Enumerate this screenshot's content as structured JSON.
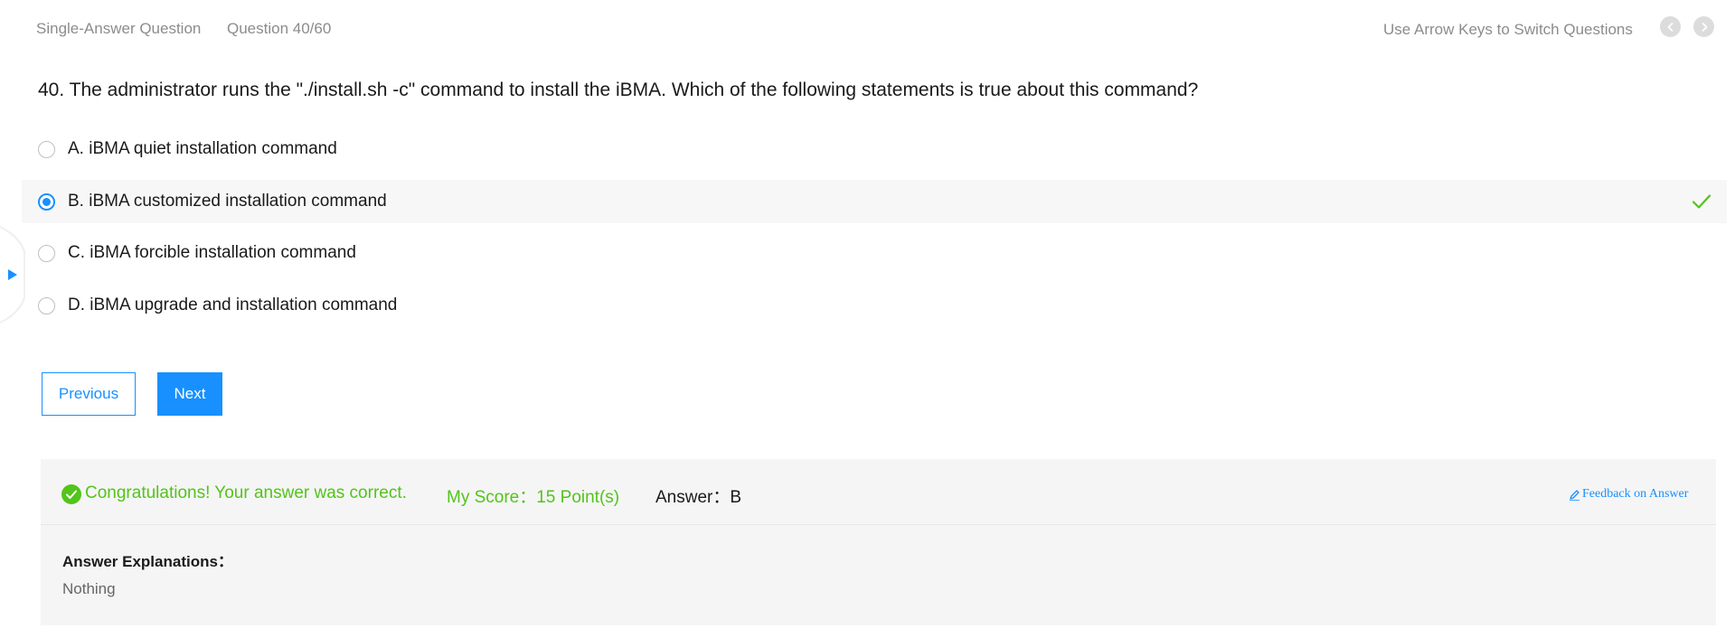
{
  "header": {
    "question_type": "Single-Answer Question",
    "question_counter": "Question 40/60",
    "nav_hint": "Use Arrow Keys to Switch Questions",
    "prev_icon": "chevron-left-icon",
    "next_icon": "chevron-right-icon"
  },
  "question": {
    "text": "40. The administrator runs the \"./install.sh -c\" command to install the iBMA. Which of the following statements is true about this command?",
    "options": [
      {
        "label": "A. iBMA quiet installation command",
        "selected": false
      },
      {
        "label": "B. iBMA customized installation command",
        "selected": true,
        "correct": true
      },
      {
        "label": "C. iBMA forcible installation command",
        "selected": false
      },
      {
        "label": "D. iBMA upgrade and installation command",
        "selected": false
      }
    ]
  },
  "buttons": {
    "previous": "Previous",
    "next": "Next"
  },
  "result": {
    "message": "Congratulations! Your answer was correct.",
    "score": "My Score：15 Point(s)",
    "answer": "Answer：B",
    "feedback": "Feedback on Answer",
    "explanation_title": "Answer Explanations：",
    "explanation_text": "Nothing"
  },
  "colors": {
    "accent": "#1890ff",
    "success": "#52c41a",
    "muted": "#8c8c8c",
    "panel_bg": "#f5f5f5"
  }
}
